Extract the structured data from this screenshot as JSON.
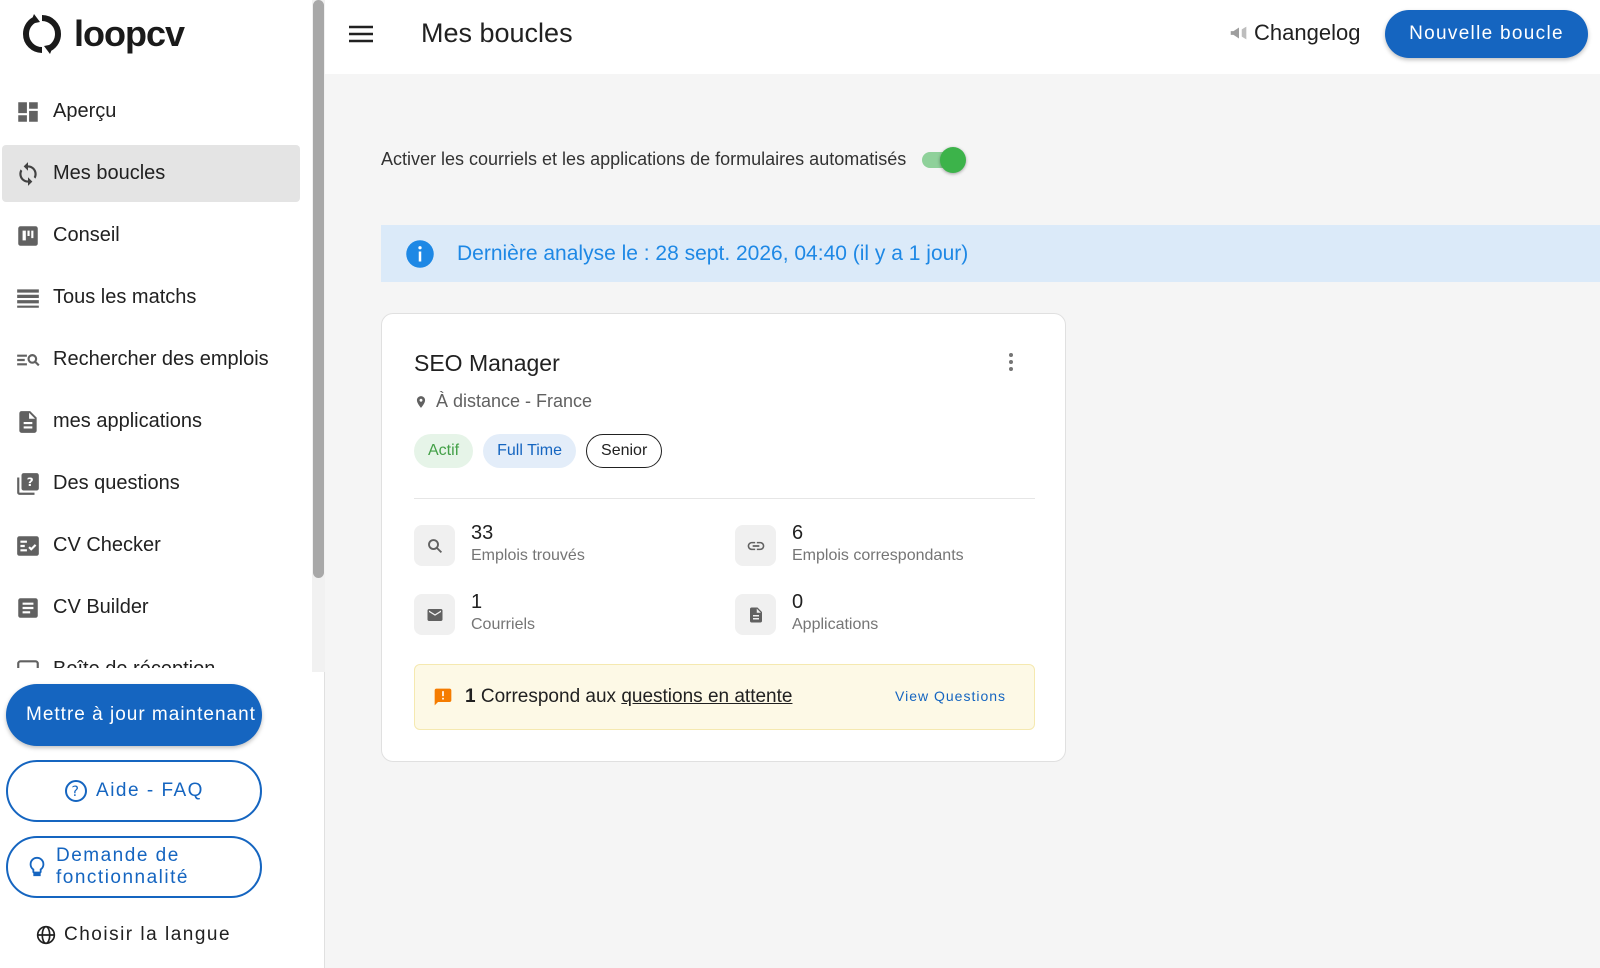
{
  "app": {
    "name": "loopcv"
  },
  "sidebar": {
    "items": [
      {
        "label": "Aperçu",
        "icon": "dashboard-icon"
      },
      {
        "label": "Mes boucles",
        "icon": "loop-icon",
        "active": true
      },
      {
        "label": "Conseil",
        "icon": "board-icon"
      },
      {
        "label": "Tous les matchs",
        "icon": "list-icon"
      },
      {
        "label": "Rechercher des emplois",
        "icon": "search-list-icon"
      },
      {
        "label": "mes applications",
        "icon": "document-icon"
      },
      {
        "label": "Des questions",
        "icon": "question-box-icon"
      },
      {
        "label": "CV Checker",
        "icon": "checklist-icon"
      },
      {
        "label": "CV Builder",
        "icon": "cv-icon"
      },
      {
        "label": "Boîte de réception",
        "icon": "inbox-icon"
      }
    ],
    "update_button": "Mettre à jour maintenant",
    "faq_button": "Aide - FAQ",
    "feature_button_line1": "Demande de",
    "feature_button_line2": "fonctionnalité",
    "language": "Choisir la langue"
  },
  "header": {
    "title": "Mes boucles",
    "changelog": "Changelog",
    "new_loop_button": "Nouvelle boucle"
  },
  "automation_toggle": {
    "label": "Activer les courriels et les applications de formulaires automatisés",
    "enabled": true
  },
  "info": {
    "text": "Dernière analyse le : 28 sept. 2026, 04:40 (il y a 1 jour)"
  },
  "loop_card": {
    "title": "SEO Manager",
    "location": "À distance - France",
    "chips": {
      "status": "Actif",
      "type": "Full Time",
      "level": "Senior"
    },
    "stats": {
      "found": {
        "value": "33",
        "label": "Emplois trouvés"
      },
      "matching": {
        "value": "6",
        "label": "Emplois correspondants"
      },
      "emails": {
        "value": "1",
        "label": "Courriels"
      },
      "applications": {
        "value": "0",
        "label": "Applications"
      }
    },
    "pending": {
      "count": "1",
      "text": " Correspond aux ",
      "link": "questions en attente",
      "action": "View Questions"
    }
  },
  "colors": {
    "primary": "#1565c0",
    "success": "#3cb34a",
    "info": "#1e88e5",
    "warning": "#f57c00"
  }
}
